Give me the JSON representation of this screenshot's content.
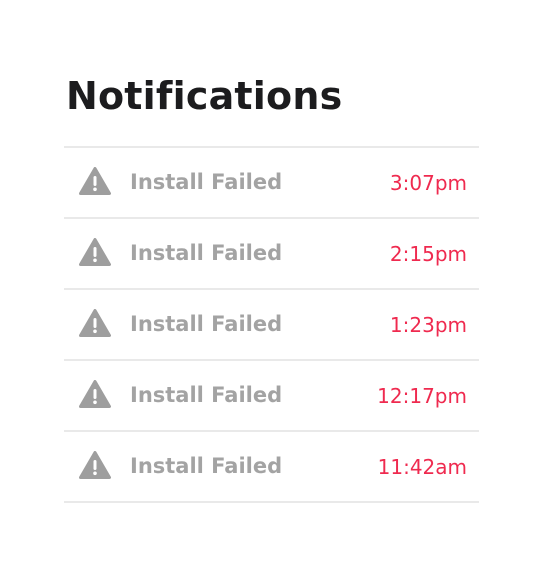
{
  "header": {
    "title": "Notifications"
  },
  "notifications": [
    {
      "icon": "warning-icon",
      "message": "Install Failed",
      "time": "3:07pm"
    },
    {
      "icon": "warning-icon",
      "message": "Install Failed",
      "time": "2:15pm"
    },
    {
      "icon": "warning-icon",
      "message": "Install Failed",
      "time": "1:23pm"
    },
    {
      "icon": "warning-icon",
      "message": "Install Failed",
      "time": "12:17pm"
    },
    {
      "icon": "warning-icon",
      "message": "Install Failed",
      "time": "11:42am"
    }
  ],
  "colors": {
    "title": "#1c1c1e",
    "message": "#a3a3a3",
    "time": "#ef2a4f",
    "divider": "#e9e9e9",
    "icon": "#9e9e9e"
  }
}
